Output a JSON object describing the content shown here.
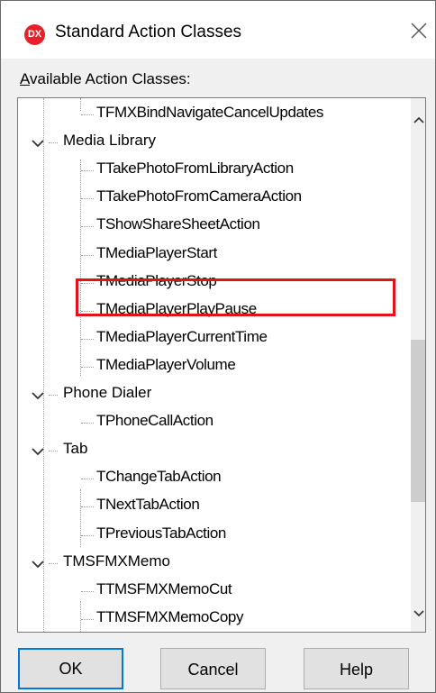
{
  "window": {
    "title": "Standard Action Classes",
    "logo_text": "DX"
  },
  "label": "Available Action Classes:",
  "tree": {
    "items": [
      {
        "text": "TFMXBindNavigateCancelUpdates",
        "type": "leaf"
      },
      {
        "text": "Media Library",
        "type": "group"
      },
      {
        "text": "TTakePhotoFromLibraryAction",
        "type": "leaf"
      },
      {
        "text": "TTakePhotoFromCameraAction",
        "type": "leaf",
        "highlighted": true
      },
      {
        "text": "TShowShareSheetAction",
        "type": "leaf"
      },
      {
        "text": "TMediaPlayerStart",
        "type": "leaf"
      },
      {
        "text": "TMediaPlayerStop",
        "type": "leaf"
      },
      {
        "text": "TMediaPlayerPlayPause",
        "type": "leaf"
      },
      {
        "text": "TMediaPlayerCurrentTime",
        "type": "leaf"
      },
      {
        "text": "TMediaPlayerVolume",
        "type": "leaf"
      },
      {
        "text": "Phone Dialer",
        "type": "group"
      },
      {
        "text": "TPhoneCallAction",
        "type": "leaf"
      },
      {
        "text": "Tab",
        "type": "group"
      },
      {
        "text": "TChangeTabAction",
        "type": "leaf"
      },
      {
        "text": "TNextTabAction",
        "type": "leaf"
      },
      {
        "text": "TPreviousTabAction",
        "type": "leaf"
      },
      {
        "text": "TMSFMXMemo",
        "type": "group"
      },
      {
        "text": "TTMSFMXMemoCut",
        "type": "leaf"
      },
      {
        "text": "TTMSFMXMemoCopy",
        "type": "leaf"
      }
    ]
  },
  "buttons": {
    "ok": "OK",
    "cancel": "Cancel",
    "help": "Help"
  },
  "colors": {
    "highlight": "#e61018",
    "default_button_border": "#0078d7"
  }
}
